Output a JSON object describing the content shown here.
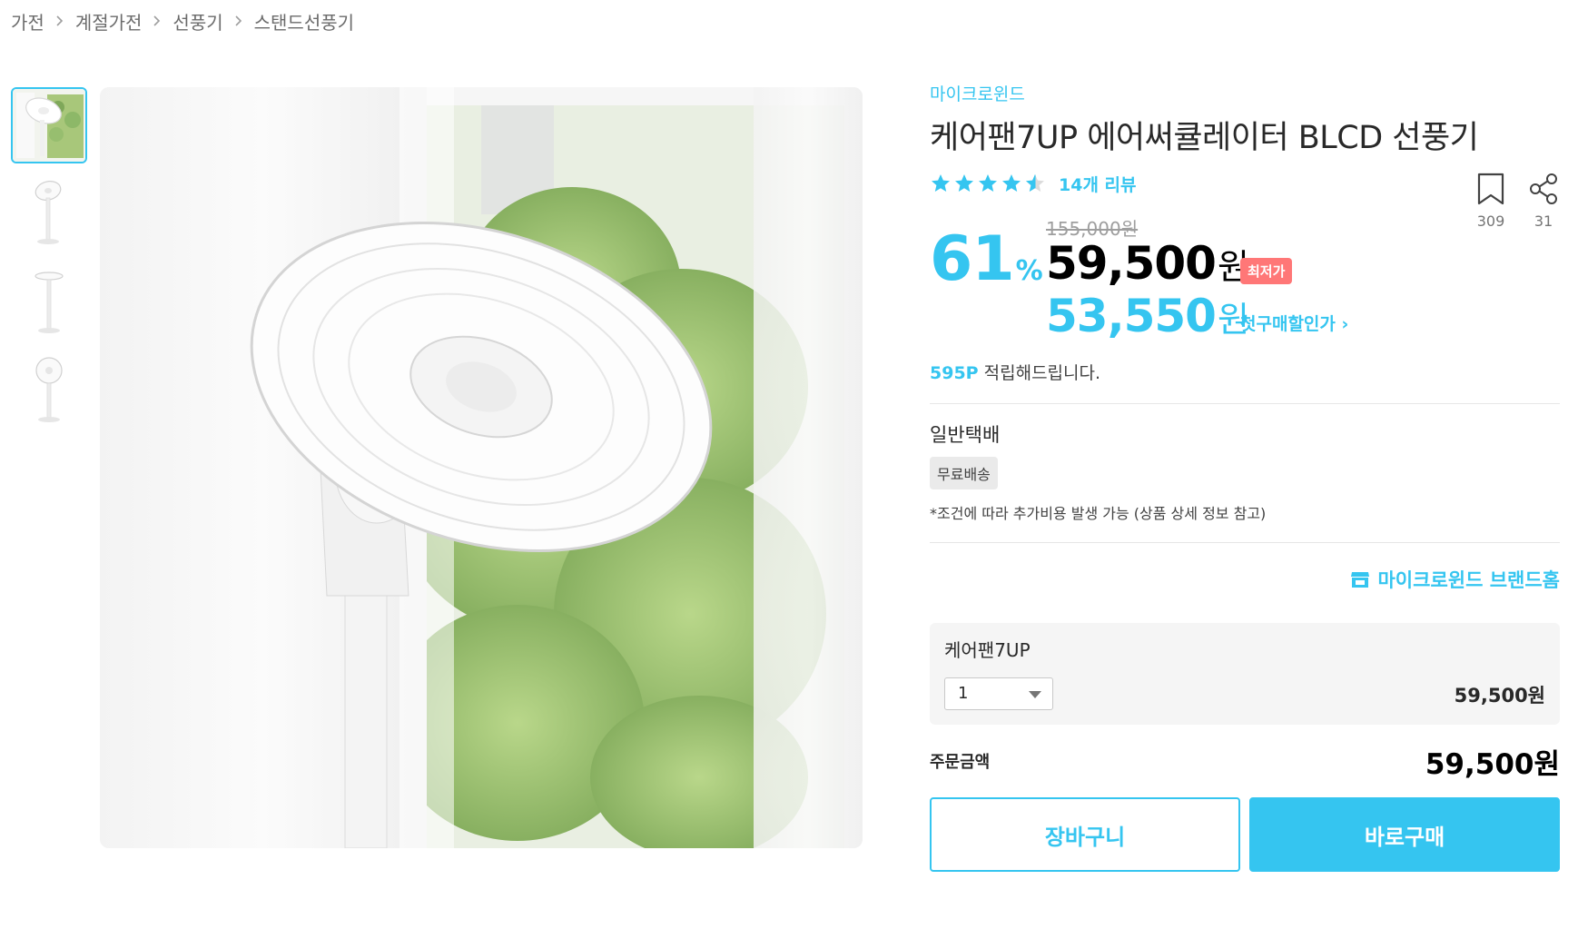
{
  "breadcrumb": [
    "가전",
    "계절가전",
    "선풍기",
    "스탠드선풍기"
  ],
  "product": {
    "brand": "마이크로윈드",
    "title": "케어팬7UP 에어써큘레이터 BLCD 선풍기",
    "rating": 4.5,
    "review_text": "14개 리뷰",
    "bookmark_count": "309",
    "share_count": "31"
  },
  "price": {
    "discount": "61",
    "discount_unit": "%",
    "original": "155,000원",
    "sale_amount": "59,500",
    "currency": "원",
    "lowest_badge": "최저가",
    "first_purchase_amount": "53,550",
    "first_purchase_link": "첫구매할인가 ›"
  },
  "points": {
    "amount": "595P",
    "text": " 적립해드립니다."
  },
  "delivery": {
    "title": "일반택배",
    "badge": "무료배송",
    "note": "*조건에 따라 추가비용 발생 가능 (상품 상세 정보 참고)"
  },
  "brand_home": "마이크로윈드 브랜드홈",
  "option": {
    "name": "케어팬7UP",
    "quantity": "1",
    "price": "59,500원"
  },
  "total": {
    "label": "주문금액",
    "value": "59,500원"
  },
  "buttons": {
    "cart": "장바구니",
    "buy": "바로구매"
  },
  "colors": {
    "accent": "#35c5f0",
    "badge_red": "#ff7777",
    "text": "#292929"
  },
  "icons": {
    "breadcrumb_separator": "chevron-right-icon",
    "bookmark": "bookmark-icon",
    "share": "share-icon",
    "brand_home": "store-icon",
    "dropdown": "caret-down-icon"
  }
}
